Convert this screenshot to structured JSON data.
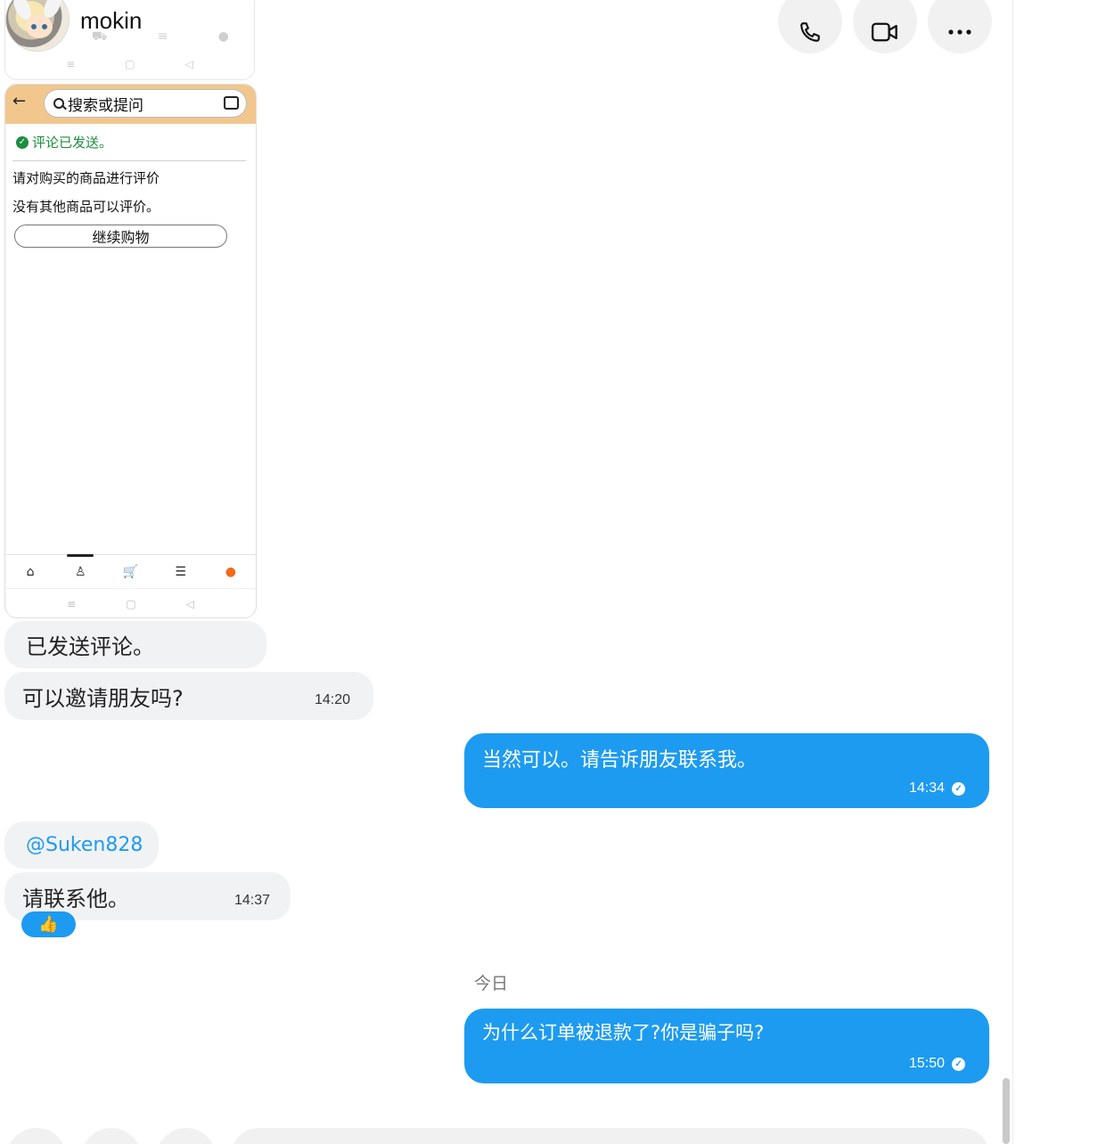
{
  "header": {
    "contact_name": "mokin",
    "buttons": [
      {
        "icon": "phone-icon"
      },
      {
        "icon": "video-icon"
      },
      {
        "icon": "more-icon"
      }
    ]
  },
  "phone_screenshot": {
    "search_placeholder": "搜索或提问",
    "sent_notice": "评论已发送。",
    "review_title": "请对购买的商品进行评价",
    "no_items": "没有其他商品可以评价。",
    "continue_button": "继续购物",
    "nav_glyphs": {
      "home": "⌂",
      "account": "♙",
      "cart": "🛒",
      "list": "☰",
      "chat": "●"
    },
    "sys_nav": [
      "≡",
      "▢",
      "◁"
    ],
    "accent_color": "#f2c78e"
  },
  "messages": [
    {
      "dir": "in",
      "text": "已发送评论。",
      "time": ""
    },
    {
      "dir": "in",
      "text": "可以邀请朋友吗?",
      "time": "14:20"
    },
    {
      "dir": "out",
      "text": "当然可以。请告诉朋友联系我。",
      "time": "14:34"
    },
    {
      "dir": "in",
      "text": "@Suken828",
      "time": ""
    },
    {
      "dir": "in",
      "text": "请联系他。",
      "time": "14:37",
      "reaction": "👍"
    },
    {
      "dir": "out",
      "text": "为什么订单被退款了?你是骗子吗?",
      "time": "15:50"
    }
  ],
  "date_separator": "今日",
  "colors": {
    "outgoing_bubble": "#1d9bf0",
    "incoming_bubble": "#f1f2f4"
  }
}
